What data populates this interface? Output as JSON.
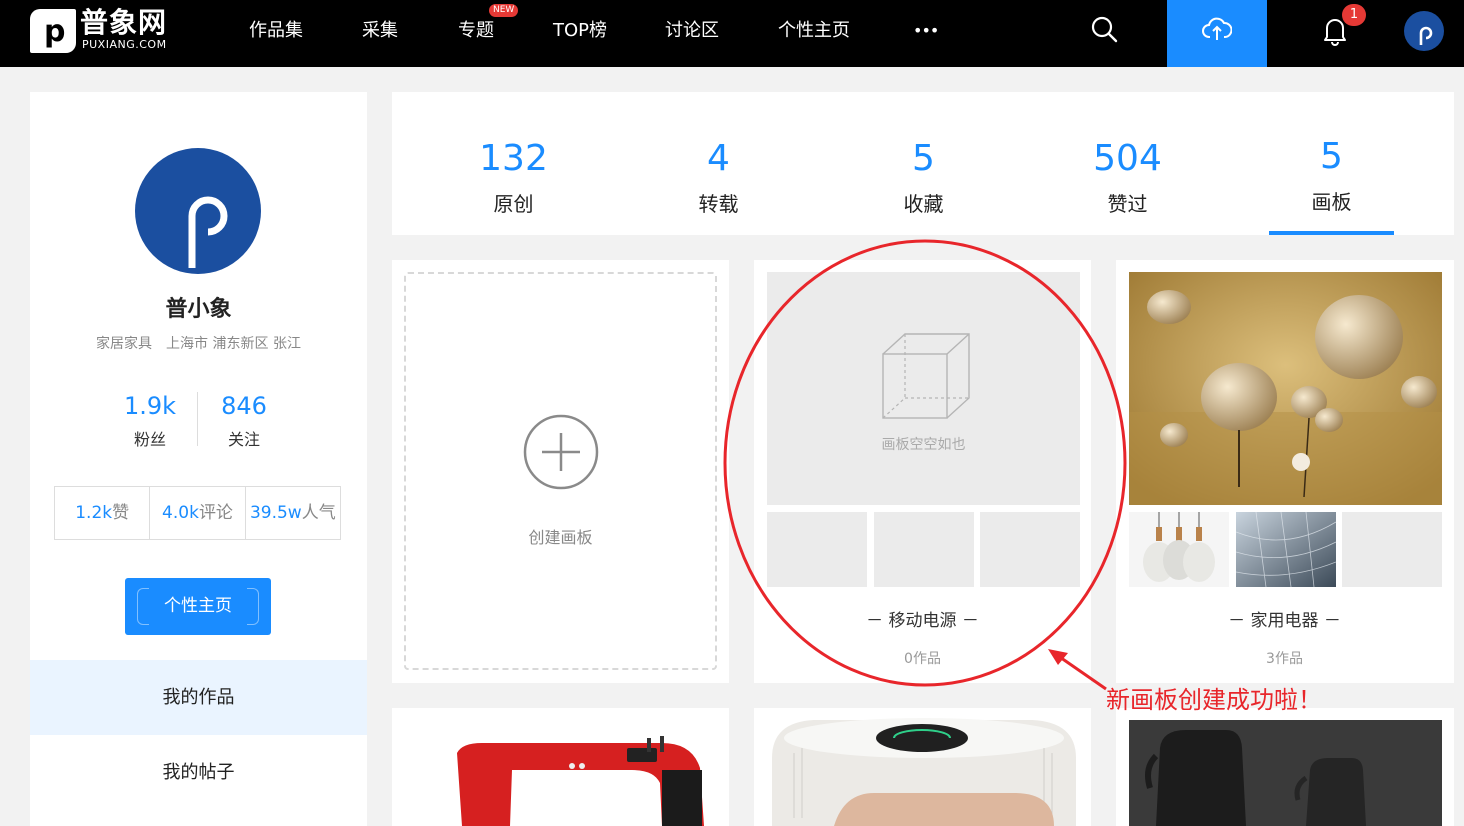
{
  "nav": {
    "logo_cn": "普象网",
    "logo_en": "PUXIANG.COM",
    "logo_letter": "p",
    "items": [
      {
        "label": "作品集"
      },
      {
        "label": "采集"
      },
      {
        "label": "专题",
        "badge": "NEW"
      },
      {
        "label": "TOP榜"
      },
      {
        "label": "讨论区"
      },
      {
        "label": "个性主页"
      },
      {
        "label": "•••"
      }
    ],
    "notification_count": "1",
    "icons": [
      "search-icon",
      "cloud-upload-icon",
      "bell-icon"
    ],
    "accent": "#1a8cff"
  },
  "profile": {
    "name": "普小象",
    "location": "家居家具　上海市 浦东新区 张江",
    "fans_count": "1.9k",
    "fans_label": "粉丝",
    "following_count": "846",
    "following_label": "关注",
    "likes_value": "1.2k",
    "likes_label": "赞",
    "comments_value": "4.0k",
    "comments_label": "评论",
    "popularity_value": "39.5w",
    "popularity_label": "人气",
    "homepage_button": "个性主页",
    "menu": [
      {
        "label": "我的作品"
      },
      {
        "label": "我的帖子"
      }
    ]
  },
  "tabs": [
    {
      "count": "132",
      "label": "原创"
    },
    {
      "count": "4",
      "label": "转载"
    },
    {
      "count": "5",
      "label": "收藏"
    },
    {
      "count": "504",
      "label": "赞过"
    },
    {
      "count": "5",
      "label": "画板"
    }
  ],
  "boards": {
    "create_label": "创建画板",
    "items": [
      {
        "name": "－ 移动电源 －",
        "count": "0作品",
        "empty_text": "画板空空如也"
      },
      {
        "name": "－ 家用电器 －",
        "count": "3作品"
      }
    ]
  },
  "annotation": {
    "text": "新画板创建成功啦！",
    "color": "#e8262b"
  }
}
